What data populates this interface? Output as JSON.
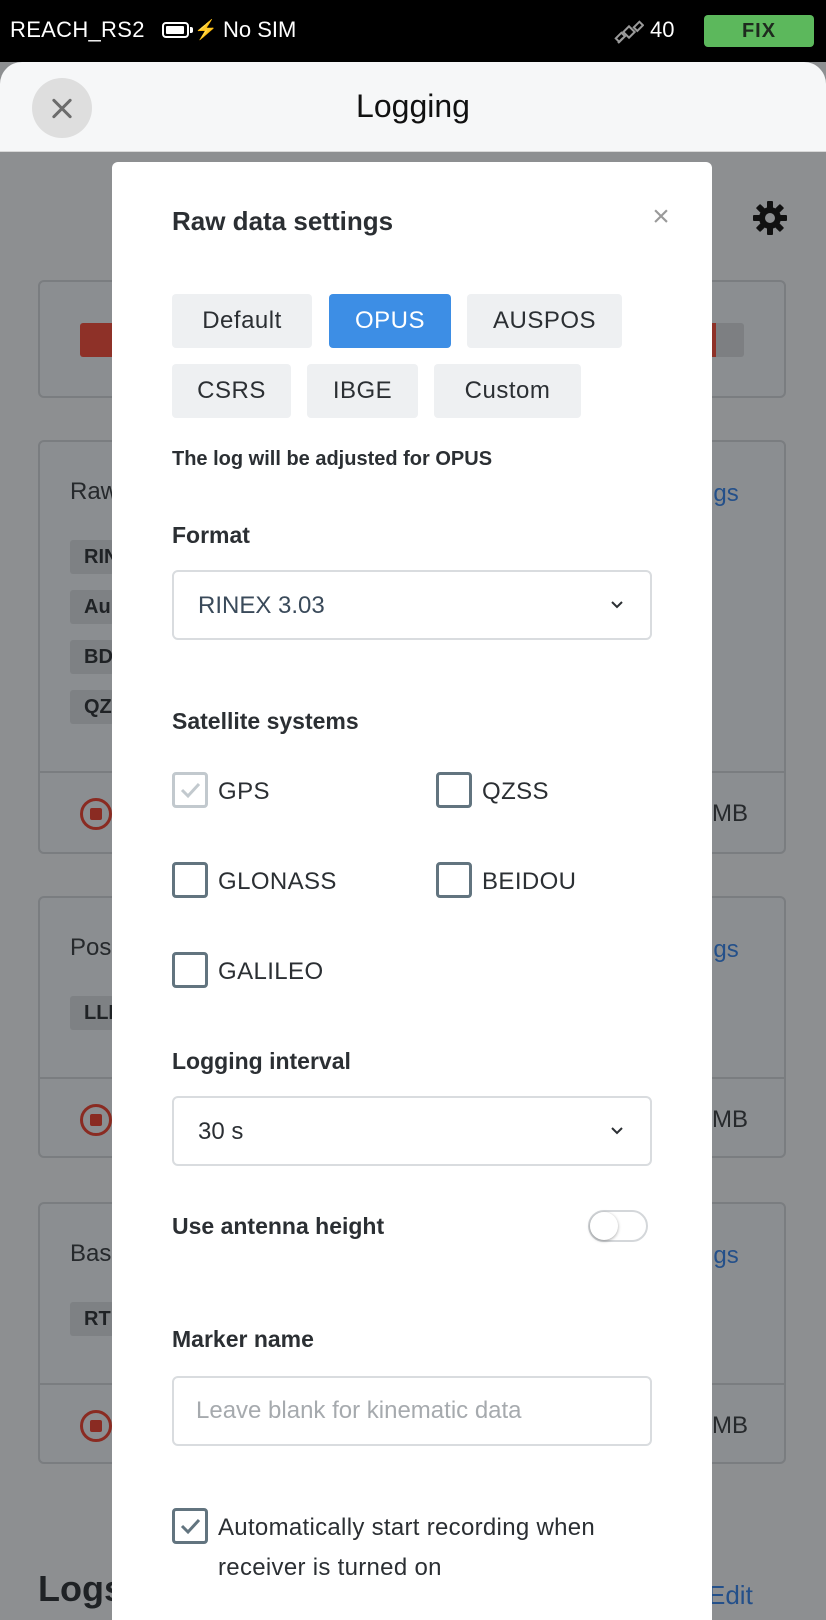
{
  "status_bar": {
    "device_name": "REACH_RS2",
    "charging_icon": "lightning-bolt-icon",
    "carrier": "No SIM",
    "satellite_icon": "satellite-icon",
    "satellite_count": "40",
    "solution_status": "FIX",
    "fix_color": "#5cb85c"
  },
  "header": {
    "title": "Logging",
    "close_icon": "close-icon"
  },
  "background": {
    "sections": [
      {
        "label": "Raw",
        "link": "ngs",
        "chips": [
          "RIN",
          "Au",
          "BD",
          "QZ"
        ],
        "size": "MB"
      },
      {
        "label": "Pos",
        "link": "ngs",
        "chips": [
          "LLI"
        ],
        "size": "MB"
      },
      {
        "label": "Bas",
        "link": "ngs",
        "chips": [
          "RT"
        ],
        "size": "MB"
      }
    ],
    "logs_heading": "Logs",
    "edit_link": "Edit"
  },
  "modal": {
    "title": "Raw data settings",
    "presets": [
      {
        "label": "Default",
        "active": false
      },
      {
        "label": "OPUS",
        "active": true
      },
      {
        "label": "AUSPOS",
        "active": false
      },
      {
        "label": "CSRS",
        "active": false
      },
      {
        "label": "IBGE",
        "active": false
      },
      {
        "label": "Custom",
        "active": false
      }
    ],
    "note": "The log will be adjusted for OPUS",
    "format": {
      "label": "Format",
      "value": "RINEX 3.03"
    },
    "satellite_systems": {
      "label": "Satellite systems",
      "items": [
        {
          "label": "GPS",
          "checked": true,
          "disabled": true
        },
        {
          "label": "QZSS",
          "checked": false
        },
        {
          "label": "GLONASS",
          "checked": false
        },
        {
          "label": "BEIDOU",
          "checked": false
        },
        {
          "label": "GALILEO",
          "checked": false
        }
      ]
    },
    "logging_interval": {
      "label": "Logging interval",
      "value": "30 s"
    },
    "antenna_height": {
      "label": "Use antenna height",
      "enabled": false
    },
    "marker_name": {
      "label": "Marker name",
      "value": "",
      "placeholder": "Leave blank for kinematic data"
    },
    "auto_start": {
      "label": "Automatically start recording when receiver is turned on",
      "checked": true
    },
    "accent_color": "#3d8ee5"
  }
}
